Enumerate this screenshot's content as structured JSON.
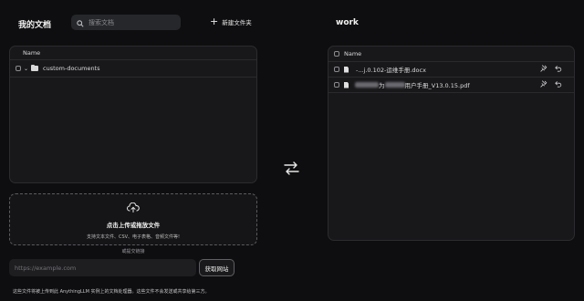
{
  "left": {
    "title": "我的文档",
    "search_placeholder": "搜索文档",
    "new_folder_label": "新建文件夹",
    "table_header": "Name",
    "rows": [
      {
        "name": "custom-documents",
        "type": "folder"
      }
    ],
    "upload": {
      "main_text": "点击上传或拖放文件",
      "sub_text": "支持文本文件、CSV、电子表格、音频文件等!"
    },
    "or_label": "或提交链接",
    "url_placeholder": "https://example.com",
    "fetch_label": "获取网站",
    "footer_text": "这些文件将被上传到此 AnythingLLM 实例上的文档处理器。这些文件不会发送或共享给第三方。"
  },
  "right": {
    "title": "work",
    "table_header": "Name",
    "rows": [
      {
        "name_visible": "-...j.0.102-运维手册.docx"
      },
      {
        "name_prefix": "为",
        "name_visible": "用户手册_V13.0.15.pdf"
      }
    ]
  },
  "icons": {
    "search": "search-icon",
    "new_folder": "plus-icon",
    "swap": "swap-arrows-icon",
    "upload": "cloud-upload-icon",
    "pin": "pin-icon",
    "undo": "undo-icon"
  }
}
